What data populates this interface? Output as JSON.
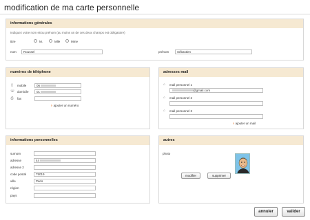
{
  "page": {
    "title": "modification de ma carte personnelle"
  },
  "general": {
    "heading": "informations générales",
    "hint": "Indiquez votre nom et/ou prénom (au moins un de ces deux champs est obligatoire)",
    "title_label": "titre",
    "titles": [
      "M.",
      "Mlle",
      "Mme"
    ],
    "nom_label": "nom",
    "nom_value": "Roussel",
    "prenom_label": "prénom",
    "prenom_value": "Sébastien"
  },
  "phones": {
    "heading": "numéros de téléphone",
    "rows": [
      {
        "label": "mobile",
        "value": "06",
        "icon": "mobile-phone-icon"
      },
      {
        "label": "domicile",
        "value": "01",
        "icon": "home-phone-icon"
      },
      {
        "label": "fax",
        "value": "",
        "icon": "fax-icon"
      }
    ],
    "add_link": "ajouter un numéro"
  },
  "emails": {
    "heading": "adresses mail",
    "rows": [
      {
        "label": "mail personnel 1",
        "value": "@gmail.com",
        "icon": "house-icon"
      },
      {
        "label": "mail personnel 2",
        "value": "",
        "icon": "house-icon"
      },
      {
        "label": "mail personnel 3",
        "value": "",
        "icon": "house-icon"
      }
    ],
    "add_link": "ajouter un mail"
  },
  "personal": {
    "heading": "informations personnelles",
    "fields": [
      {
        "label": "surnom",
        "value": ""
      },
      {
        "label": "adresse",
        "value": "44"
      },
      {
        "label": "adresse 2",
        "value": ""
      },
      {
        "label": "code postal",
        "value": "75019"
      },
      {
        "label": "ville",
        "value": "Paris"
      },
      {
        "label": "région",
        "value": ""
      },
      {
        "label": "pays",
        "value": ""
      }
    ]
  },
  "others": {
    "heading": "autres",
    "photo_label": "photo",
    "modify_button": "modifier",
    "delete_button": "supprimer"
  },
  "footer": {
    "cancel_button": "annuler",
    "validate_button": "valider"
  },
  "colors": {
    "panel_header": "#f6e9d2",
    "accent_chevron": "#e05a00"
  }
}
